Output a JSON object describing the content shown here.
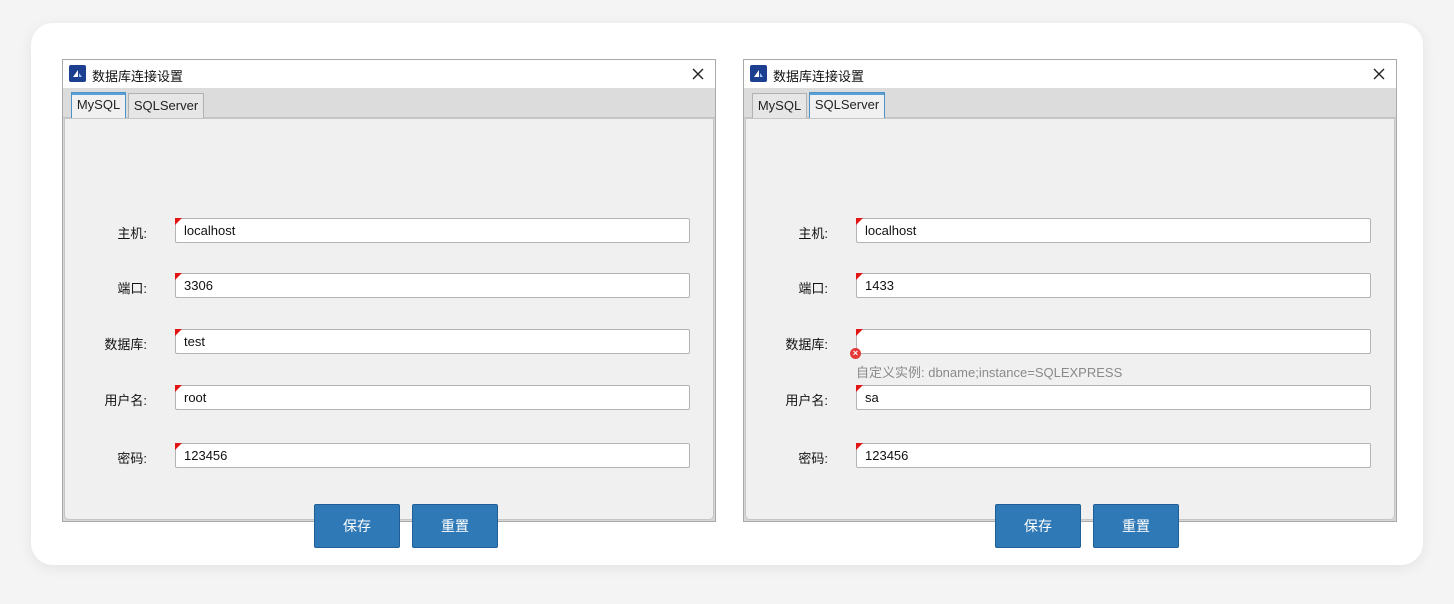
{
  "dialogs": [
    {
      "title": "数据库连接设置",
      "tabs": [
        {
          "label": "MySQL",
          "active": true
        },
        {
          "label": "SQLServer",
          "active": false
        }
      ],
      "fields": {
        "host": {
          "label": "主机:",
          "value": "localhost"
        },
        "port": {
          "label": "端口:",
          "value": "3306"
        },
        "database": {
          "label": "数据库:",
          "value": "test"
        },
        "username": {
          "label": "用户名:",
          "value": "root"
        },
        "password": {
          "label": "密码:",
          "value": "123456"
        }
      },
      "buttons": {
        "save": "保存",
        "reset": "重置"
      }
    },
    {
      "title": "数据库连接设置",
      "tabs": [
        {
          "label": "MySQL",
          "active": false
        },
        {
          "label": "SQLServer",
          "active": true
        }
      ],
      "fields": {
        "host": {
          "label": "主机:",
          "value": "localhost"
        },
        "port": {
          "label": "端口:",
          "value": "1433"
        },
        "database": {
          "label": "数据库:",
          "value": "",
          "hint": "自定义实例: dbname;instance=SQLEXPRESS"
        },
        "username": {
          "label": "用户名:",
          "value": "sa"
        },
        "password": {
          "label": "密码:",
          "value": "123456"
        }
      },
      "buttons": {
        "save": "保存",
        "reset": "重置"
      }
    }
  ],
  "colors": {
    "button_bg": "#3079b7",
    "required_marker": "#e21515",
    "active_tab_border": "#4a93c8",
    "app_icon_bg": "#1d3f8f"
  },
  "icons": {
    "app": "database-settings-icon",
    "close": "close-icon",
    "error": "error-icon"
  }
}
